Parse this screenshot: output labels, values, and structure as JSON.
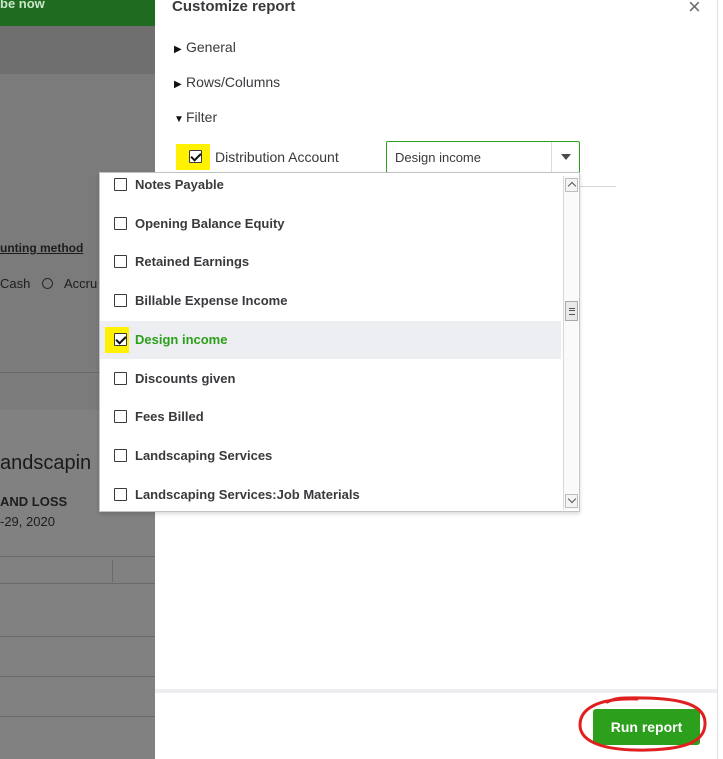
{
  "background": {
    "banner_text": "be now",
    "accounting_method_label": "unting method",
    "cash_label": "Cash",
    "accrual_label": "Accru",
    "company_name": "andscapin",
    "report_name": "AND LOSS",
    "date_range": "-29, 2020"
  },
  "panel": {
    "title": "Customize report",
    "sections": [
      {
        "label": "General",
        "expanded": false
      },
      {
        "label": "Rows/Columns",
        "expanded": false
      },
      {
        "label": "Filter",
        "expanded": true
      }
    ],
    "filter": {
      "distribution_account_label": "Distribution Account",
      "distribution_account_checked": true,
      "selected_value": "Design income"
    },
    "run_report_label": "Run report"
  },
  "dropdown": {
    "items": [
      {
        "label": "Notes Payable",
        "checked": false
      },
      {
        "label": "Opening Balance Equity",
        "checked": false
      },
      {
        "label": "Retained Earnings",
        "checked": false
      },
      {
        "label": "Billable Expense Income",
        "checked": false
      },
      {
        "label": "Design income",
        "checked": true
      },
      {
        "label": "Discounts given",
        "checked": false
      },
      {
        "label": "Fees Billed",
        "checked": false
      },
      {
        "label": "Landscaping Services",
        "checked": false
      },
      {
        "label": "Landscaping Services:Job Materials",
        "checked": false
      }
    ]
  },
  "colors": {
    "accent": "#2ca01c",
    "highlight": "#fff100",
    "annotation": "#e02020",
    "overlay": "#7b7b7b"
  }
}
